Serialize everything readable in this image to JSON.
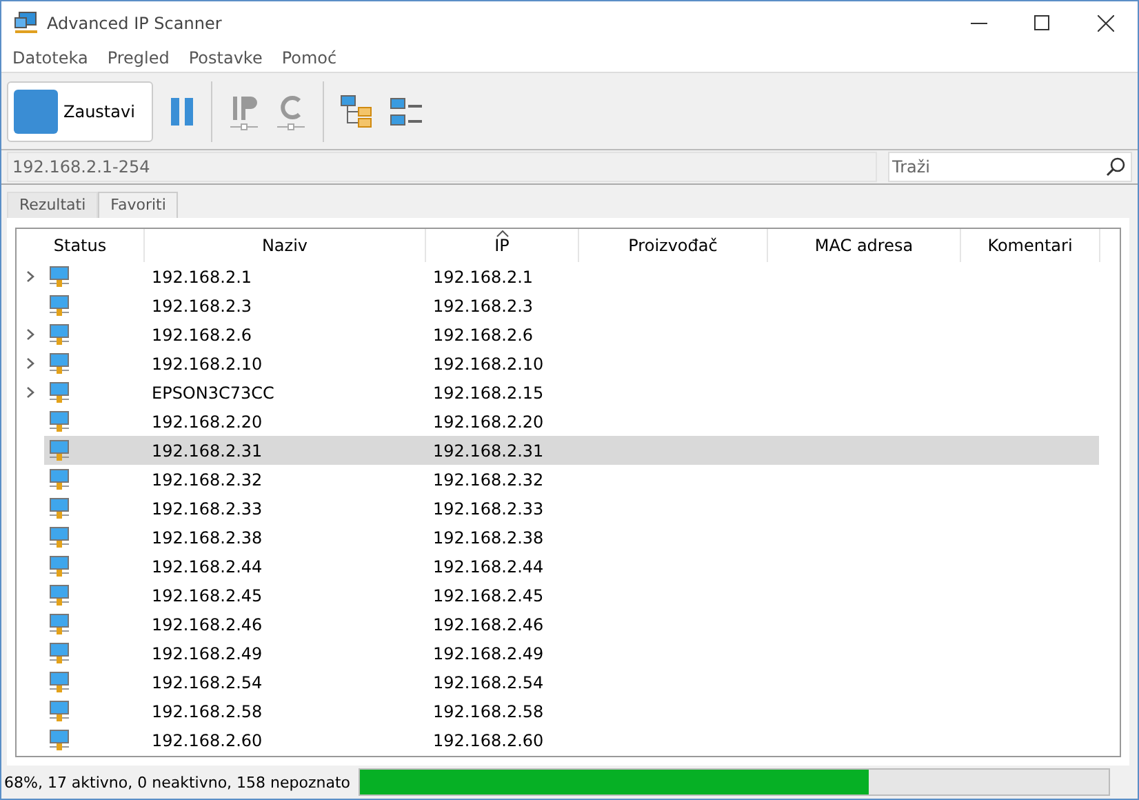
{
  "window": {
    "title": "Advanced IP Scanner"
  },
  "menu": [
    "Datoteka",
    "Pregled",
    "Postavke",
    "Pomoć"
  ],
  "toolbar": {
    "scan_button": "Zaustavi"
  },
  "address_range": "192.168.2.1-254",
  "search": {
    "placeholder": "Traži"
  },
  "tabs": [
    {
      "label": "Rezultati",
      "selected": true
    },
    {
      "label": "Favoriti",
      "selected": false
    }
  ],
  "table": {
    "columns": [
      "Status",
      "Naziv",
      "IP",
      "Proizvođač",
      "MAC adresa",
      "Komentari"
    ],
    "rows": [
      {
        "expandable": true,
        "selected": false,
        "name": "192.168.2.1",
        "ip": "192.168.2.1"
      },
      {
        "expandable": false,
        "selected": false,
        "name": "192.168.2.3",
        "ip": "192.168.2.3"
      },
      {
        "expandable": true,
        "selected": false,
        "name": "192.168.2.6",
        "ip": "192.168.2.6"
      },
      {
        "expandable": true,
        "selected": false,
        "name": "192.168.2.10",
        "ip": "192.168.2.10"
      },
      {
        "expandable": true,
        "selected": false,
        "name": "EPSON3C73CC",
        "ip": "192.168.2.15"
      },
      {
        "expandable": false,
        "selected": false,
        "name": "192.168.2.20",
        "ip": "192.168.2.20"
      },
      {
        "expandable": false,
        "selected": true,
        "name": "192.168.2.31",
        "ip": "192.168.2.31"
      },
      {
        "expandable": false,
        "selected": false,
        "name": "192.168.2.32",
        "ip": "192.168.2.32"
      },
      {
        "expandable": false,
        "selected": false,
        "name": "192.168.2.33",
        "ip": "192.168.2.33"
      },
      {
        "expandable": false,
        "selected": false,
        "name": "192.168.2.38",
        "ip": "192.168.2.38"
      },
      {
        "expandable": false,
        "selected": false,
        "name": "192.168.2.44",
        "ip": "192.168.2.44"
      },
      {
        "expandable": false,
        "selected": false,
        "name": "192.168.2.45",
        "ip": "192.168.2.45"
      },
      {
        "expandable": false,
        "selected": false,
        "name": "192.168.2.46",
        "ip": "192.168.2.46"
      },
      {
        "expandable": false,
        "selected": false,
        "name": "192.168.2.49",
        "ip": "192.168.2.49"
      },
      {
        "expandable": false,
        "selected": false,
        "name": "192.168.2.54",
        "ip": "192.168.2.54"
      },
      {
        "expandable": false,
        "selected": false,
        "name": "192.168.2.58",
        "ip": "192.168.2.58"
      },
      {
        "expandable": false,
        "selected": false,
        "name": "192.168.2.60",
        "ip": "192.168.2.60"
      }
    ]
  },
  "status_bar": {
    "text": "68%, 17 aktivno, 0 neaktivno, 158 nepoznato",
    "level": 0.68
  }
}
